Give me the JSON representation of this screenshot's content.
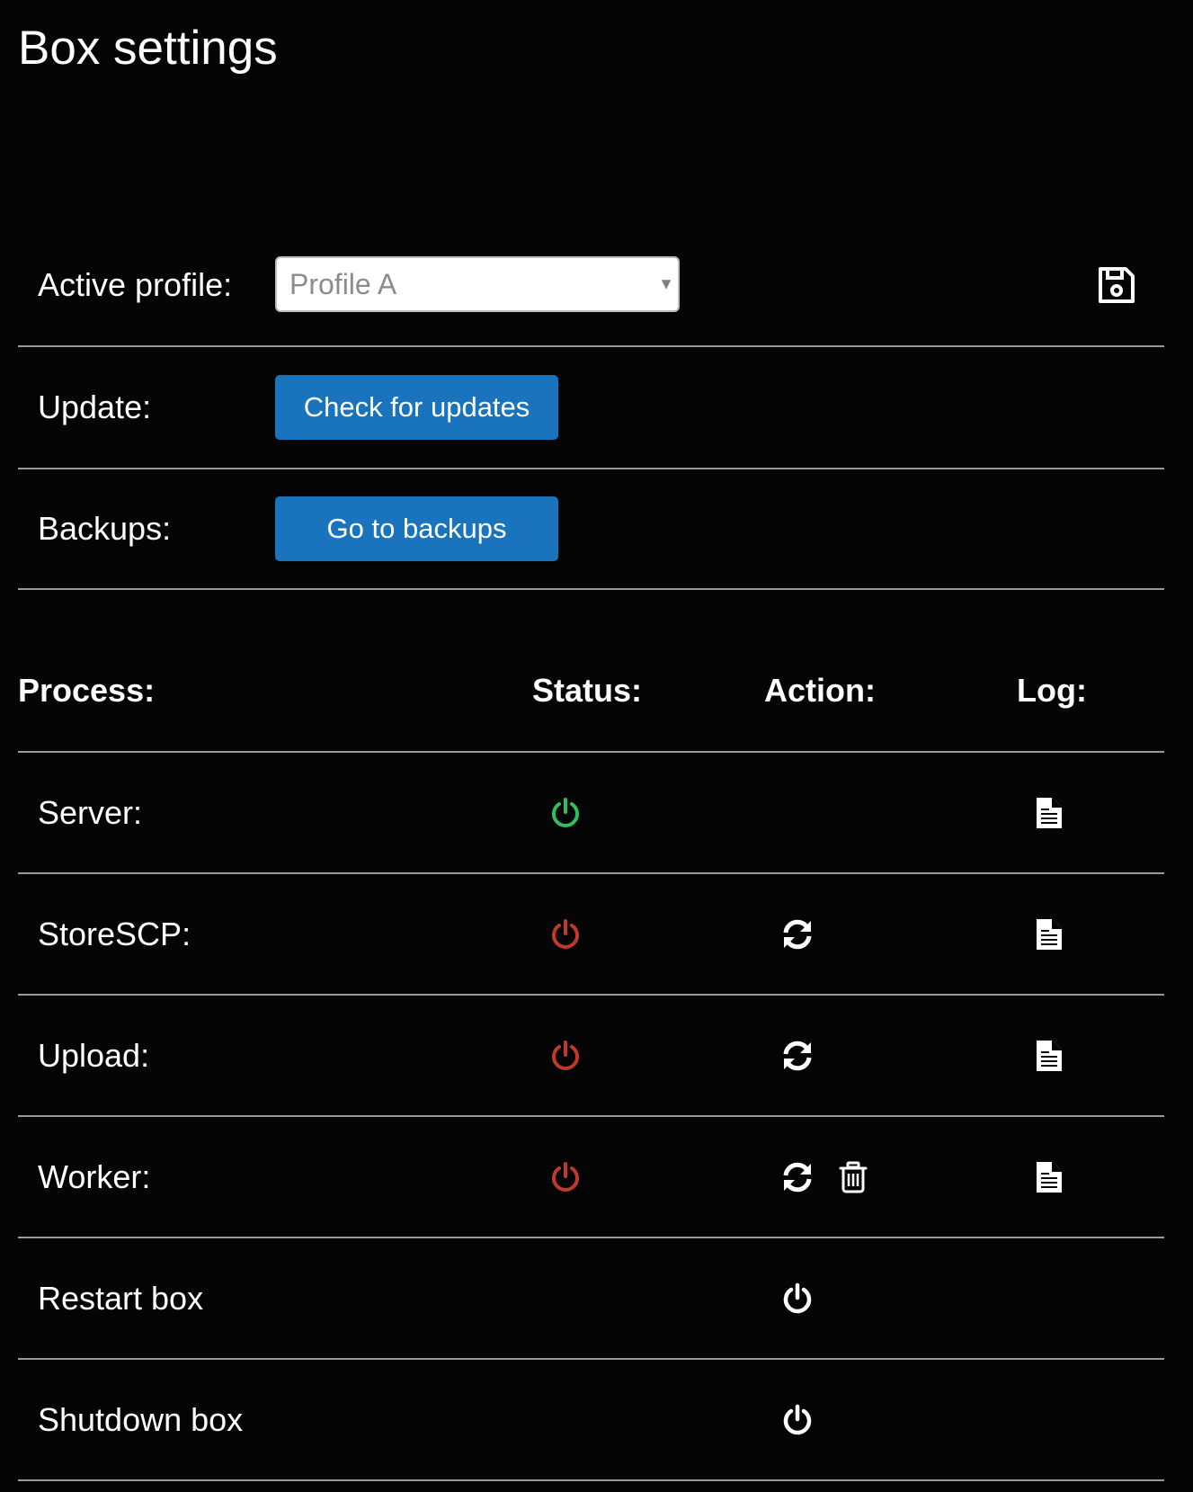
{
  "page": {
    "title": "Box settings"
  },
  "colors": {
    "background": "#050505",
    "divider": "#9a9a9a",
    "button": "#1a73bd",
    "status_on": "#2fbf5f",
    "status_off": "#c0392b"
  },
  "profile": {
    "label": "Active profile:",
    "selected": "Profile A",
    "arrow": "▼",
    "save_icon": "floppy-disk-icon"
  },
  "update": {
    "label": "Update:",
    "button": "Check for updates"
  },
  "backups": {
    "label": "Backups:",
    "button": "Go to backups"
  },
  "table": {
    "headers": {
      "process": "Process:",
      "status": "Status:",
      "action": "Action:",
      "log": "Log:"
    },
    "rows": [
      {
        "name": "Server:",
        "status": "running",
        "actions": [],
        "log": "document-icon"
      },
      {
        "name": "StoreSCP:",
        "status": "stopped",
        "actions": [
          "refresh-icon"
        ],
        "log": "document-icon"
      },
      {
        "name": "Upload:",
        "status": "stopped",
        "actions": [
          "refresh-icon"
        ],
        "log": "document-icon"
      },
      {
        "name": "Worker:",
        "status": "stopped",
        "actions": [
          "refresh-icon",
          "trash-icon"
        ],
        "log": "document-icon"
      }
    ]
  },
  "system": {
    "restart_label": "Restart box",
    "shutdown_label": "Shutdown box",
    "power_icon": "power-icon"
  }
}
